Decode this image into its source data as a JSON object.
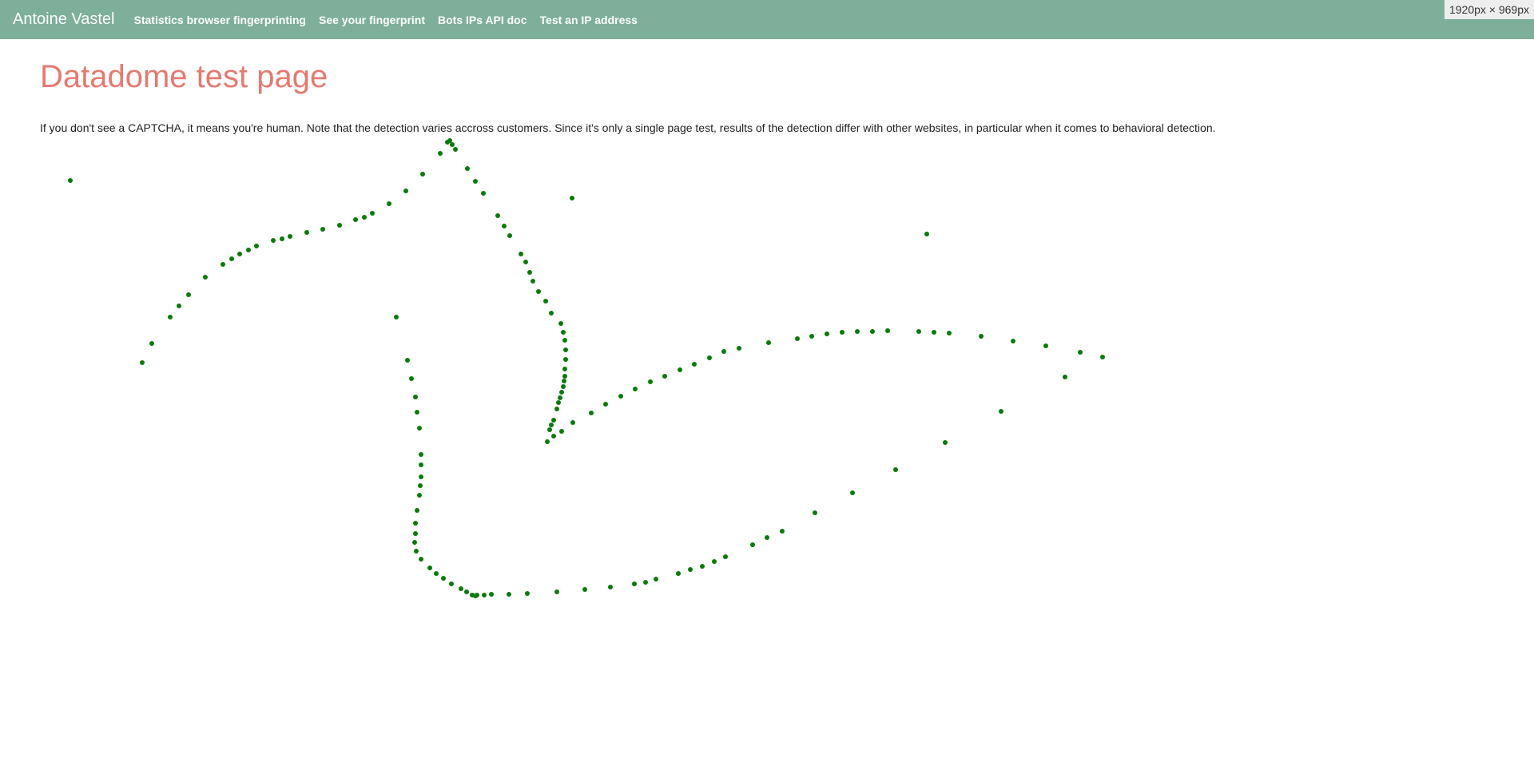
{
  "header": {
    "brand": "Antoine Vastel",
    "links": [
      {
        "label": "Statistics browser fingerprinting"
      },
      {
        "label": "See your fingerprint"
      },
      {
        "label": "Bots IPs API doc"
      },
      {
        "label": "Test an IP address"
      }
    ]
  },
  "viewport_badge": "1920px × 969px",
  "page": {
    "title": "Datadome test page",
    "intro": "If you don't see a CAPTCHA, it means you're human. Note that the detection varies accross customers. Since it's only a single page test, results of the detection differ with other websites, in particular when it comes to behavioral detection."
  },
  "colors": {
    "navbar": "#7daf9a",
    "title": "#e57a71",
    "trail_dot": "#0a7a0a"
  }
}
